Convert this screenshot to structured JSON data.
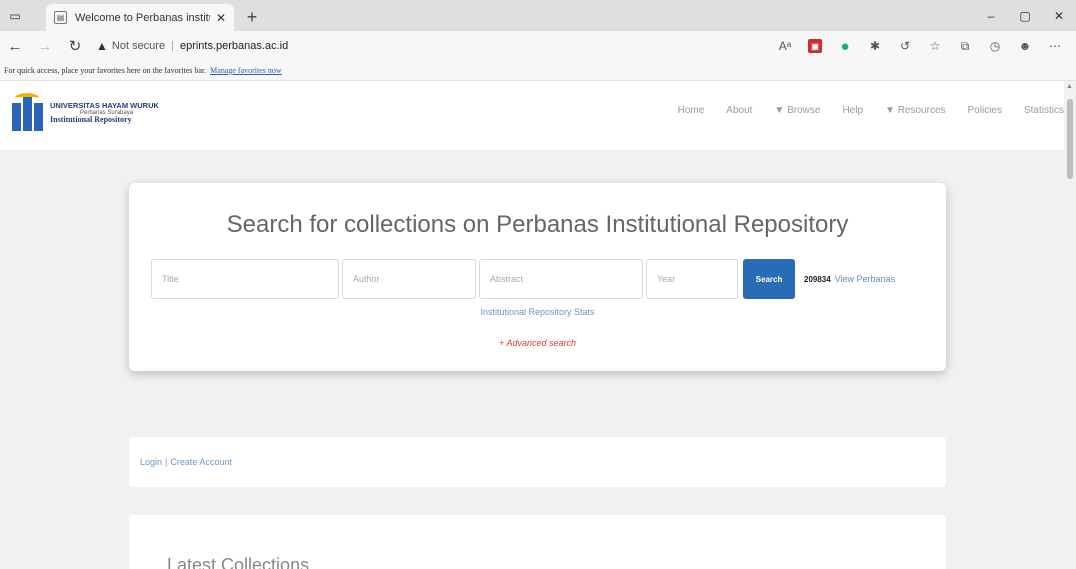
{
  "browser": {
    "tab_title": "Welcome to Perbanas institutio",
    "tab_favicon": "document-icon",
    "url_warning": "Not secure",
    "url": "eprints.perbanas.ac.id",
    "favorites_text": "For quick access, place your favorites here on the favorites bar.",
    "favorites_link": "Manage favorites now",
    "colors": {
      "pdf_ext": "#d42b2b",
      "green_ext": "#1ab26b"
    }
  },
  "site": {
    "logo": {
      "line1": "UNIVERSITAS HAYAM WURUK",
      "line2": "Perbanas Surabaya",
      "line3": "Institutional Repository"
    },
    "nav": [
      "Home",
      "About",
      "▼ Browse",
      "Help",
      "▼ Resources",
      "Policies",
      "Statistics"
    ]
  },
  "search": {
    "title": "Search for collections on Perbanas Institutional Repository",
    "placeholders": {
      "title": "Title",
      "author": "Author",
      "abstract": "Abstract",
      "year": "Year"
    },
    "button": "Search",
    "counter": "209834",
    "view_link": "View Perbanas",
    "stats_link": "Institutional Repository Stats",
    "advanced": "+ Advanced search",
    "colors": {
      "button": "#2a6bb5",
      "advanced": "#e03a2f"
    }
  },
  "account": {
    "login": "Login",
    "create": "Create Account"
  },
  "latest": {
    "heading": "Latest Collections"
  }
}
